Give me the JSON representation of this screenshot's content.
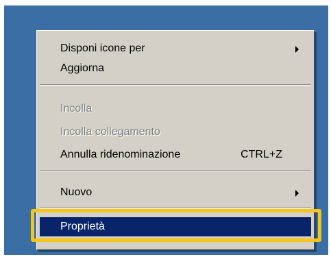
{
  "context_menu": {
    "items": [
      {
        "label": "Disponi icone per",
        "has_submenu": true,
        "enabled": true
      },
      {
        "label": "Aggiorna",
        "enabled": true
      },
      {
        "label": "Incolla",
        "enabled": false
      },
      {
        "label": "Incolla collegamento",
        "enabled": false
      },
      {
        "label": "Annulla ridenominazione",
        "shortcut": "CTRL+Z",
        "enabled": true
      },
      {
        "label": "Nuovo",
        "has_submenu": true,
        "enabled": true
      },
      {
        "label": "Proprietà",
        "enabled": true,
        "selected": true
      }
    ]
  },
  "colors": {
    "desktop_background": "#3a6ea5",
    "menu_background": "#d4d0c8",
    "selection_background": "#0a246a",
    "highlight_border": "#f5c518"
  }
}
